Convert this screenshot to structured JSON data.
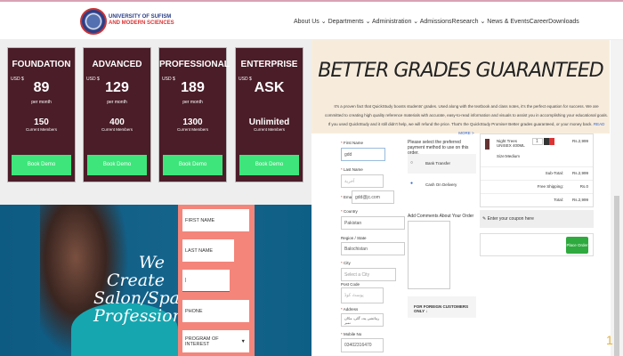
{
  "header": {
    "logo_line1": "UNIVERSITY OF SUFISM",
    "logo_line2": "AND MODERN SCIENCES",
    "nav": [
      "About Us ⌄",
      "Departments ⌄",
      "Administration ⌄",
      "Admissions",
      "Research ⌄",
      "News & Events",
      "Career",
      "Downloads"
    ]
  },
  "pricing": [
    {
      "title": "FOUNDATION",
      "currency": "USD $",
      "price": "89",
      "period": "per month",
      "members": "150",
      "members_label": "Current Members",
      "button": "Book Demo"
    },
    {
      "title": "ADVANCED",
      "currency": "USD $",
      "price": "129",
      "period": "per month",
      "members": "400",
      "members_label": "Current Members",
      "button": "Book Demo"
    },
    {
      "title": "PROFESSIONAL",
      "currency": "USD $",
      "price": "189",
      "period": "per month",
      "members": "1300",
      "members_label": "Current Members",
      "button": "Book Demo"
    },
    {
      "title": "ENTERPRISE",
      "currency": "USD $",
      "price": "ASK",
      "period": "",
      "members": "Unlimited",
      "members_label": "Current Members",
      "button": "Book Demo"
    }
  ],
  "salon": {
    "headline": "We Create Salon/Spa Professionals",
    "fields": [
      "FIRST NAME",
      "LAST NAME",
      "",
      "PHONE",
      "PROGRAM OF INTEREST"
    ]
  },
  "promo": {
    "title": "BETTER GRADES GUARANTEED",
    "text": "It's a proven fact that QuickStudy boosts students' grades. Used along with the textbook and class notes, it's the perfect equation for success. We are committed to creating high quality reference materials with accurate, easy-to-read information and visuals to assist you in accomplishing your educational goals. If you used QuickStudy and it still didn't help, we will refund the price. That's the QuickStudy Promise! Better grades guaranteed, or your money back.",
    "link": "READ MORE >"
  },
  "checkout": {
    "first_name_label": "First Name",
    "first_name": "gdd",
    "last_name_label": "Last Name",
    "last_name": "آخرية",
    "email_label": "Email",
    "email": "gdd@jc.com",
    "country_label": "Country",
    "country": "Pakistan",
    "region_label": "Region / State",
    "region": "Balochistan",
    "city_label": "City",
    "city": "Select a City",
    "post_label": "Post Code",
    "post": "پوسٹ کوڈ",
    "address_label": "Address",
    "address": "رہائشی پتہ، گلی، مکان نمبر",
    "mobile_label": "Mobile No",
    "mobile": "03402316470",
    "payment_prompt": "Please select the preferred payment method to use on this order.",
    "payment_options": [
      "Bank Transfer",
      "Cash On Delivery"
    ],
    "comments_label": "Add Comments About Your Order",
    "foreign": "FOR FOREIGN CUSTOMERS ONLY ↓",
    "product": "Night Trees UNISEX 400ML",
    "product_sub": "Size:Medium",
    "qty": "1",
    "price": "Rs.2,999",
    "subtotal_label": "Sub-Total:",
    "subtotal": "Rs.2,999",
    "shipping_label": "Free Shipping:",
    "shipping": "Rs.0",
    "total_label": "Total:",
    "total": "Rs.2,999",
    "coupon": "Enter your coupon here",
    "place_order": "Place Order"
  },
  "corner": "1"
}
